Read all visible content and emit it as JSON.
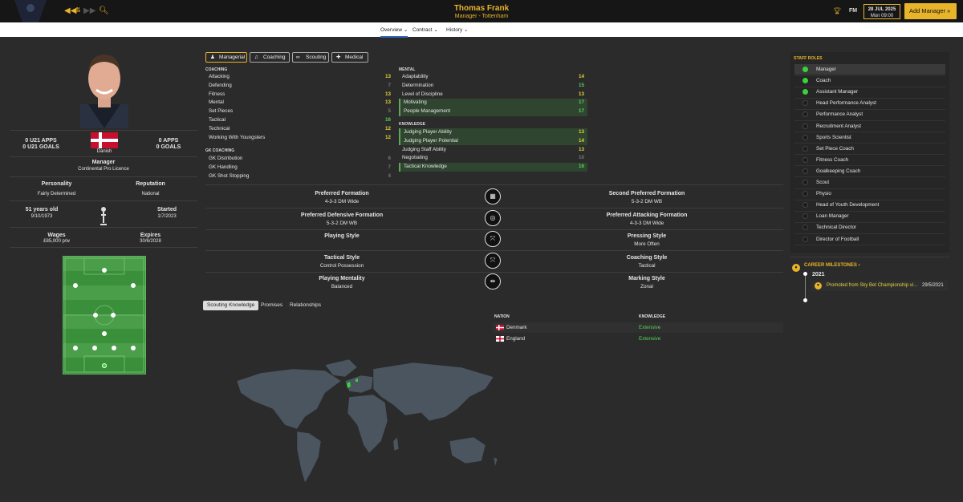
{
  "header": {
    "title": "Thomas Frank",
    "subtitle": "Manager - Tottenham",
    "date": "28 JUL 2025",
    "time": "Mon 09:00",
    "add_manager": "Add Manager",
    "fm": "FM"
  },
  "tabs": [
    {
      "label": "Overview ⌄"
    },
    {
      "label": "Contract ⌄"
    },
    {
      "label": "History ⌄"
    }
  ],
  "profile": {
    "u21_apps": "0 U21 APPS",
    "u21_goals": "0 U21 GOALS",
    "apps": "0 APPS",
    "goals": "0 GOALS",
    "nationality": "Danish",
    "role": "Manager",
    "licence": "Continental Pro Licence",
    "personality_label": "Personality",
    "personality": "Fairly Determined",
    "reputation_label": "Reputation",
    "reputation": "National",
    "age": "51 years old",
    "dob": "9/10/1973",
    "started_label": "Started",
    "started": "1/7/2023",
    "wages_label": "Wages",
    "wages": "£85,000 p/w",
    "expires_label": "Expires",
    "expires": "30/6/2028"
  },
  "category_tabs": [
    {
      "label": "Managerial"
    },
    {
      "label": "Coaching"
    },
    {
      "label": "Scouting"
    },
    {
      "label": "Medical"
    }
  ],
  "sections": {
    "coaching": "COACHING",
    "gk": "GK COACHING",
    "mental": "MENTAL",
    "knowledge": "KNOWLEDGE"
  },
  "coaching": [
    {
      "n": "Attacking",
      "v": "13"
    },
    {
      "n": "Defending",
      "v": "7"
    },
    {
      "n": "Fitness",
      "v": "13"
    },
    {
      "n": "Mental",
      "v": "13"
    },
    {
      "n": "Set Pieces",
      "v": "5"
    },
    {
      "n": "Tactical",
      "v": "16"
    },
    {
      "n": "Technical",
      "v": "12"
    },
    {
      "n": "Working With Youngsters",
      "v": "12"
    }
  ],
  "gk": [
    {
      "n": "GK Distribution",
      "v": "6"
    },
    {
      "n": "GK Handling",
      "v": "7"
    },
    {
      "n": "GK Shot Stopping",
      "v": "4"
    }
  ],
  "mental": [
    {
      "n": "Adaptability",
      "v": "14"
    },
    {
      "n": "Determination",
      "v": "15"
    },
    {
      "n": "Level of Discipline",
      "v": "13"
    },
    {
      "n": "Motivating",
      "v": "17"
    },
    {
      "n": "People Management",
      "v": "17"
    }
  ],
  "knowledge": [
    {
      "n": "Judging Player Ability",
      "v": "13"
    },
    {
      "n": "Judging Player Potential",
      "v": "14"
    },
    {
      "n": "Judging Staff Ability",
      "v": "13"
    },
    {
      "n": "Negotiating",
      "v": "10"
    },
    {
      "n": "Tactical Knowledge",
      "v": "16"
    }
  ],
  "styles": [
    {
      "lt": "Preferred Formation",
      "ls": "4-3-3 DM Wide",
      "rt": "Second Preferred Formation",
      "rs": "5-3-2 DM WB"
    },
    {
      "lt": "Preferred Defensive Formation",
      "ls": "5-3-2 DM WB",
      "rt": "Preferred Attacking Formation",
      "rs": "4-3-3 DM Wide"
    },
    {
      "lt": "Playing Style",
      "ls": "",
      "rt": "Pressing Style",
      "rs": "More Often"
    },
    {
      "lt": "Tactical Style",
      "ls": "Control Possession",
      "rt": "Coaching Style",
      "rs": "Tactical"
    },
    {
      "lt": "Playing Mentality",
      "ls": "Balanced",
      "rt": "Marking Style",
      "rs": "Zonal"
    }
  ],
  "bottom_tabs": [
    {
      "label": "Scouting Knowledge"
    },
    {
      "label": "Promises"
    },
    {
      "label": "Relationships"
    }
  ],
  "nations": {
    "col1": "NATION",
    "col2": "KNOWLEDGE",
    "rows": [
      {
        "n": "Denmark",
        "k": "Extensive"
      },
      {
        "n": "England",
        "k": "Extensive"
      }
    ]
  },
  "staff_roles_title": "STAFF ROLES",
  "roles": [
    {
      "n": "Manager",
      "on": true
    },
    {
      "n": "Coach",
      "on": true
    },
    {
      "n": "Assistant Manager",
      "on": true
    },
    {
      "n": "Head Performance Analyst",
      "on": false
    },
    {
      "n": "Performance Analyst",
      "on": false
    },
    {
      "n": "Recruitment Analyst",
      "on": false
    },
    {
      "n": "Sports Scientist",
      "on": false
    },
    {
      "n": "Set Piece Coach",
      "on": false
    },
    {
      "n": "Fitness Coach",
      "on": false
    },
    {
      "n": "Goalkeeping Coach",
      "on": false
    },
    {
      "n": "Scout",
      "on": false
    },
    {
      "n": "Physio",
      "on": false
    },
    {
      "n": "Head of Youth Development",
      "on": false
    },
    {
      "n": "Loan Manager",
      "on": false
    },
    {
      "n": "Technical Director",
      "on": false
    },
    {
      "n": "Director of Football",
      "on": false
    }
  ],
  "milestones": {
    "title": "CAREER MILESTONES ›",
    "year": "2021",
    "text": "Promoted from Sky Bet Championship vi...",
    "date": "29/5/2021"
  },
  "colors": {
    "accent": "#e8b42a",
    "green": "#56d156",
    "yellow": "#e8d23a"
  }
}
